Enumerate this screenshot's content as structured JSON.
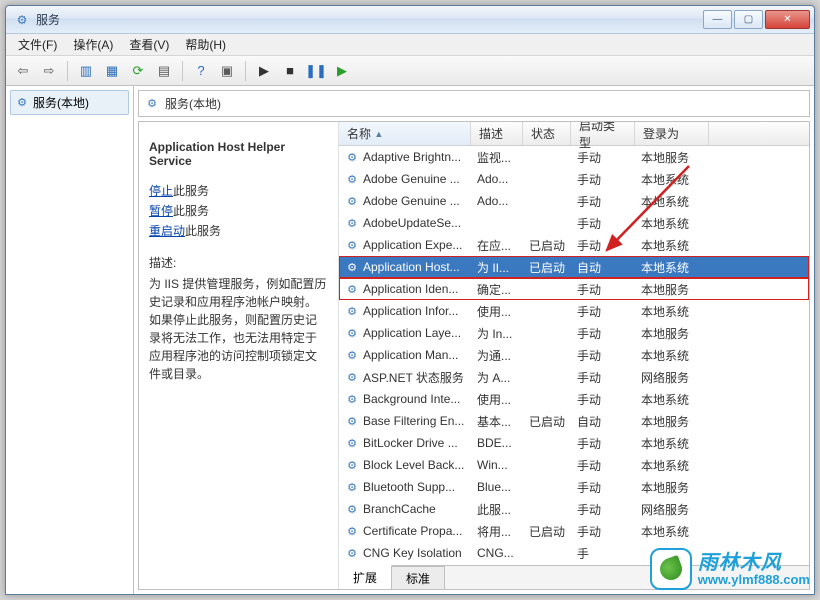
{
  "window": {
    "title": "服务"
  },
  "menubar": [
    "文件(F)",
    "操作(A)",
    "查看(V)",
    "帮助(H)"
  ],
  "leftPane": {
    "rootLabel": "服务(本地)"
  },
  "rightHeader": "服务(本地)",
  "detail": {
    "serviceName": "Application Host Helper Service",
    "actions": {
      "stop": "停止",
      "pause": "暂停",
      "restart": "重启动",
      "suffix": "此服务"
    },
    "descLabel": "描述:",
    "description": "为 IIS 提供管理服务，例如配置历史记录和应用程序池帐户映射。如果停止此服务，则配置历史记录将无法工作，也无法用特定于应用程序池的访问控制项锁定文件或目录。"
  },
  "columns": {
    "name": "名称",
    "desc": "描述",
    "status": "状态",
    "startup": "启动类型",
    "logon": "登录为"
  },
  "services": [
    {
      "name": "Adaptive Brightn...",
      "desc": "监视...",
      "status": "",
      "startup": "手动",
      "logon": "本地服务"
    },
    {
      "name": "Adobe Genuine ...",
      "desc": "Ado...",
      "status": "",
      "startup": "手动",
      "logon": "本地系统"
    },
    {
      "name": "Adobe Genuine ...",
      "desc": "Ado...",
      "status": "",
      "startup": "手动",
      "logon": "本地系统"
    },
    {
      "name": "AdobeUpdateSe...",
      "desc": "",
      "status": "",
      "startup": "手动",
      "logon": "本地系统"
    },
    {
      "name": "Application Expe...",
      "desc": "在应...",
      "status": "已启动",
      "startup": "手动",
      "logon": "本地系统"
    },
    {
      "name": "Application Host...",
      "desc": "为 II...",
      "status": "已启动",
      "startup": "自动",
      "logon": "本地系统",
      "selected": true
    },
    {
      "name": "Application Iden...",
      "desc": "确定...",
      "status": "",
      "startup": "手动",
      "logon": "本地服务"
    },
    {
      "name": "Application Infor...",
      "desc": "使用...",
      "status": "",
      "startup": "手动",
      "logon": "本地系统"
    },
    {
      "name": "Application Laye...",
      "desc": "为 In...",
      "status": "",
      "startup": "手动",
      "logon": "本地服务"
    },
    {
      "name": "Application Man...",
      "desc": "为通...",
      "status": "",
      "startup": "手动",
      "logon": "本地系统"
    },
    {
      "name": "ASP.NET 状态服务",
      "desc": "为 A...",
      "status": "",
      "startup": "手动",
      "logon": "网络服务"
    },
    {
      "name": "Background Inte...",
      "desc": "使用...",
      "status": "",
      "startup": "手动",
      "logon": "本地系统"
    },
    {
      "name": "Base Filtering En...",
      "desc": "基本...",
      "status": "已启动",
      "startup": "自动",
      "logon": "本地服务"
    },
    {
      "name": "BitLocker Drive ...",
      "desc": "BDE...",
      "status": "",
      "startup": "手动",
      "logon": "本地系统"
    },
    {
      "name": "Block Level Back...",
      "desc": "Win...",
      "status": "",
      "startup": "手动",
      "logon": "本地系统"
    },
    {
      "name": "Bluetooth Supp...",
      "desc": "Blue...",
      "status": "",
      "startup": "手动",
      "logon": "本地服务"
    },
    {
      "name": "BranchCache",
      "desc": "此服...",
      "status": "",
      "startup": "手动",
      "logon": "网络服务"
    },
    {
      "name": "Certificate Propa...",
      "desc": "将用...",
      "status": "已启动",
      "startup": "手动",
      "logon": "本地系统"
    },
    {
      "name": "CNG Key Isolation",
      "desc": "CNG...",
      "status": "",
      "startup": "手",
      "logon": ""
    }
  ],
  "tabs": {
    "extended": "扩展",
    "standard": "标准"
  },
  "watermark": {
    "cn": "雨林木风",
    "url": "www.ylmf888.com"
  }
}
